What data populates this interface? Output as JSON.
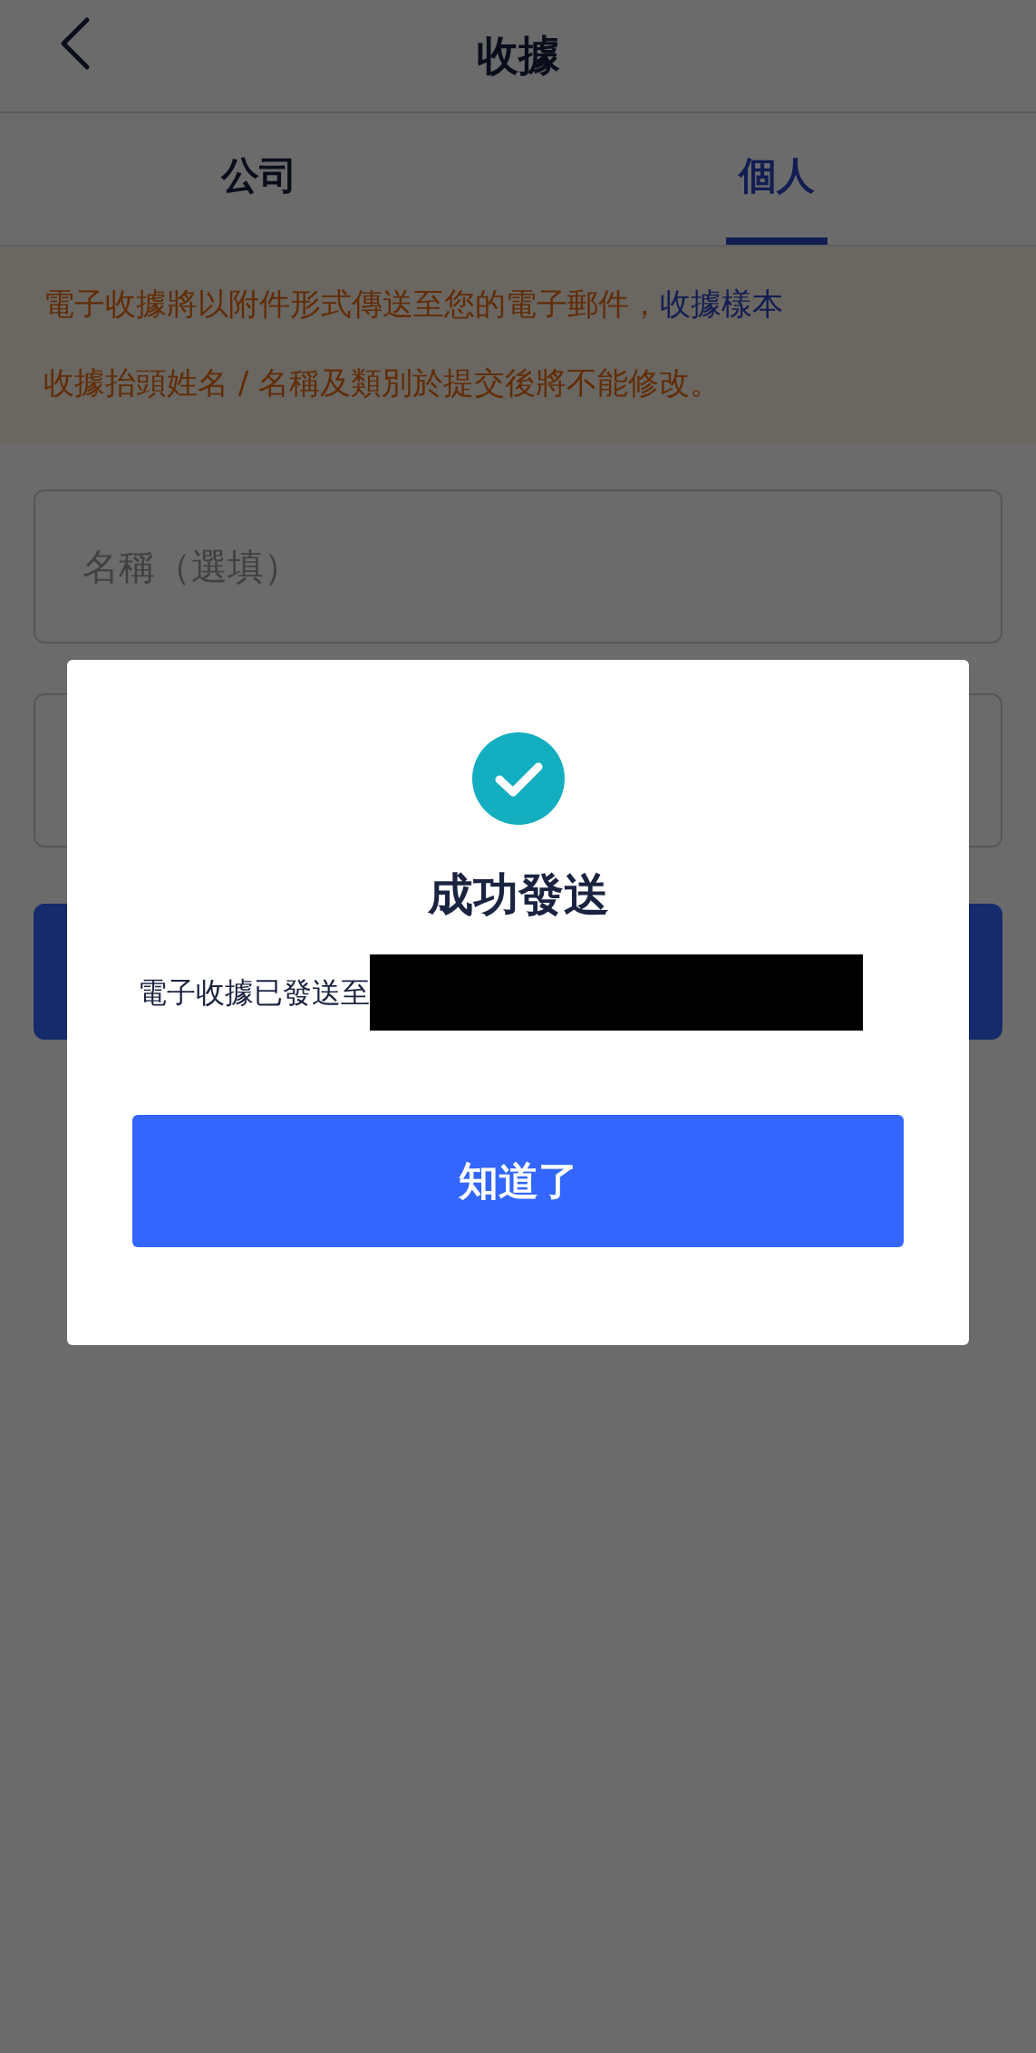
{
  "header": {
    "title": "收據"
  },
  "tabs": [
    {
      "label": "公司",
      "selected": false
    },
    {
      "label": "個人",
      "selected": true
    }
  ],
  "notice": {
    "text": "電子收據將以附件形式傳送至您的電子郵件，",
    "link": "收據樣本",
    "note": "收據抬頭姓名 / 名稱及類別於提交後將不能修改。"
  },
  "fields": [
    {
      "kind": "text",
      "placeholder": "名稱（選填）"
    },
    {
      "kind": "text"
    }
  ],
  "submit": {
    "kind": "button"
  },
  "dialog": {
    "title": "成功發送",
    "message": "電子收據已發送至",
    "redacted": true,
    "button": "知道了"
  }
}
